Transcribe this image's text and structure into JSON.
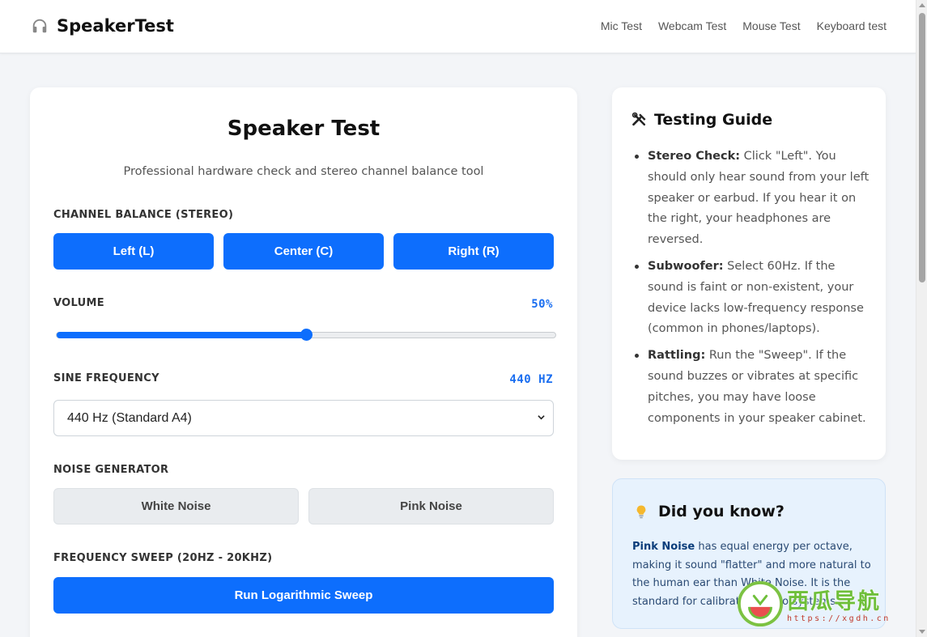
{
  "header": {
    "logo_text": "SpeakerTest",
    "nav": [
      "Mic Test",
      "Webcam Test",
      "Mouse Test",
      "Keyboard test"
    ]
  },
  "main": {
    "title": "Speaker Test",
    "subtitle": "Professional hardware check and stereo channel balance tool",
    "channel": {
      "label": "CHANNEL BALANCE (STEREO)",
      "buttons": [
        "Left (L)",
        "Center (C)",
        "Right (R)"
      ]
    },
    "volume": {
      "label": "VOLUME",
      "value_text": "50%",
      "value": 50
    },
    "frequency": {
      "label": "SINE FREQUENCY",
      "value_text": "440 HZ",
      "selected": "440 Hz (Standard A4)"
    },
    "noise": {
      "label": "NOISE GENERATOR",
      "buttons": [
        "White Noise",
        "Pink Noise"
      ]
    },
    "sweep": {
      "label": "FREQUENCY SWEEP (20HZ - 20KHZ)",
      "button": "Run Logarithmic Sweep"
    }
  },
  "guide": {
    "title": "Testing Guide",
    "items": [
      {
        "term": "Stereo Check:",
        "text": " Click \"Left\". You should only hear sound from your left speaker or earbud. If you hear it on the right, your headphones are reversed."
      },
      {
        "term": "Subwoofer:",
        "text": " Select 60Hz. If the sound is faint or non-existent, your device lacks low-frequency response (common in phones/laptops)."
      },
      {
        "term": "Rattling:",
        "text": " Run the \"Sweep\". If the sound buzzes or vibrates at specific pitches, you may have loose components in your speaker cabinet."
      }
    ]
  },
  "know": {
    "title": "Did you know?",
    "term": "Pink Noise",
    "text": " has equal energy per octave, making it sound \"flatter\" and more natural to the human ear than White Noise. It is the standard for calibrating audio systems."
  },
  "watermark": {
    "text": "西瓜导航",
    "url": "https://xgdh.cn"
  },
  "colors": {
    "accent": "#0d6efd",
    "value_text": "#1a6ef0",
    "know_bg": "#e7f2fd"
  }
}
